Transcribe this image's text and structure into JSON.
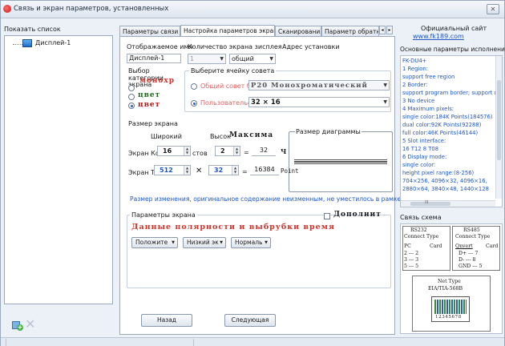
{
  "window": {
    "title": "Связь и экран параметров, установленных",
    "close_label": "✕"
  },
  "left": {
    "list_label": "Показать список",
    "items": [
      {
        "label": "Дисплей-1"
      }
    ],
    "remove_label": "✕"
  },
  "tabs": [
    {
      "label": "Параметры связи"
    },
    {
      "label": "Настройка параметров экрана"
    },
    {
      "label": "Сканирования"
    },
    {
      "label": "Параметр обратн"
    }
  ],
  "tab_scroll": {
    "left": "◂",
    "right": "▸"
  },
  "screen_tab": {
    "display_name_label": "Отображаемое имя",
    "screen_count_label": "Количество экрана зисплея",
    "address_label": "Адрес установки",
    "display_name_value": "Дисплей-1",
    "screen_count_value": "1",
    "address_value": "общий",
    "category_label_1": "Выбор",
    "category_label_2": "категории",
    "category_label_3": "экрана",
    "category_options": [
      {
        "label": "монохр",
        "checked": false
      },
      {
        "label": "цвет",
        "checked": false
      },
      {
        "label": "цвет",
        "checked": true
      }
    ],
    "cell_group_label": "Выберите ячейку совета",
    "cell_options": [
      {
        "label": "Общий совет бло",
        "value": "P20 Монохроматический",
        "checked": false
      },
      {
        "label": "Пользовательск",
        "value": "32 × 16",
        "checked": true
      }
    ],
    "size_group_label": "Размер экрана",
    "width_label": "Широкий",
    "height_label": "Высок",
    "max_label": "Максима",
    "diagram_size_label": "Размер диаграммы",
    "screen_k_label": "Экран Ко",
    "width_count": "16",
    "pieces_label": "стов",
    "height_count": "2",
    "eq1": "=",
    "total_count": "32",
    "count_suffix": "Ч",
    "screen_t_label": "Экран Т",
    "width_px": "512",
    "times": "✕",
    "height_px": "32",
    "eq2": "=",
    "total_px": "16384",
    "total_px_suffix": "Point",
    "warning": "Размер изменения, оригинальное содержание неизменным, не уместилось в рамке быт",
    "polarity_group_label": "Параметры экрана",
    "extra_label": "Дополнит",
    "polarity_heading": "Данные полярности и выбрубки время",
    "dd_polarity": "Положите",
    "dd_oe": "Низкий эк",
    "dd_mode": "Нормаль"
  },
  "nav": {
    "back": "Назад",
    "next": "Следующая"
  },
  "right": {
    "official_site_label": "Официальный сайт",
    "official_site_url": "www.fk189.com",
    "params_title": "Основные параметры исполнения",
    "params_lines": [
      "FK-DU4+",
      "1 Region:",
      "  support free region",
      "2 Border:",
      "  support program border; support r",
      "3 No device",
      "4 Maximum pixels:",
      "  single color:184K Points(184576)",
      "  dual color:92K Points(92288)",
      "  full color:46K Points(46144)",
      "5 Slot interface:",
      "  16 T12  8 T08",
      "6 Display mode:",
      "  single color:",
      "  height pixel range:(8-256)",
      "  704×256, 4096×32, 4096×16,",
      "  2880×64, 3840×48, 1440×128"
    ],
    "scroll_mid": "III",
    "connection_title": "Связь схема",
    "rs232_title": "RS232",
    "rs232_sub": "Connect Type",
    "rs232_head": [
      "PC",
      "Card"
    ],
    "rs232_rows": [
      "2  ---  2",
      "3  ---  3",
      "5  ---  5"
    ],
    "rs485_title": "RS485",
    "rs485_sub": "Connect Type",
    "rs485_head": [
      "Qnvert",
      "Card"
    ],
    "rs485_rows": [
      "D+ ---  7",
      "D- ---  8",
      "GND --- 5"
    ],
    "net_title": "Net Type",
    "net_sub": "EIA/TIA-568B",
    "net_pins": "12345678"
  }
}
